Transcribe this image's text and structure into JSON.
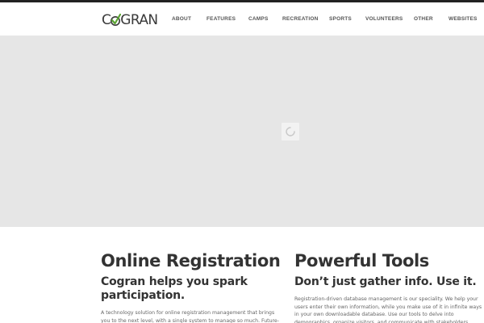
{
  "brand": {
    "logo_prefix": "C",
    "logo_suffix": "GRAN",
    "logo_full": "COGRAN",
    "check_color": "#5aa532"
  },
  "nav": {
    "items": [
      {
        "label": "ABOUT"
      },
      {
        "label": "FEATURES"
      },
      {
        "label": "CAMPS"
      },
      {
        "label": "RECREATION"
      },
      {
        "label": "SPORTS"
      },
      {
        "label": "VOLUNTEERS"
      },
      {
        "label": "OTHER"
      },
      {
        "label": "WEBSITES"
      }
    ]
  },
  "hero": {
    "background": "#e6e6e6",
    "loading_icon": "spinner-icon"
  },
  "sections": [
    {
      "title": "Online Registration",
      "subtitle": "Cogran helps you spark participation.",
      "body": "A technology solution for online registration management that brings you to the next level, with a single system to manage so much. Future-"
    },
    {
      "title": "Powerful Tools",
      "subtitle": "Don’t just gather info. Use it.",
      "body": "Registration-driven database management is our speciality. We help your users enter their own information, while you make use of it in infinite ways in your own downloadable database. Use our tools to delve into demographics, organize visitors, and communicate with stakeholders."
    }
  ]
}
